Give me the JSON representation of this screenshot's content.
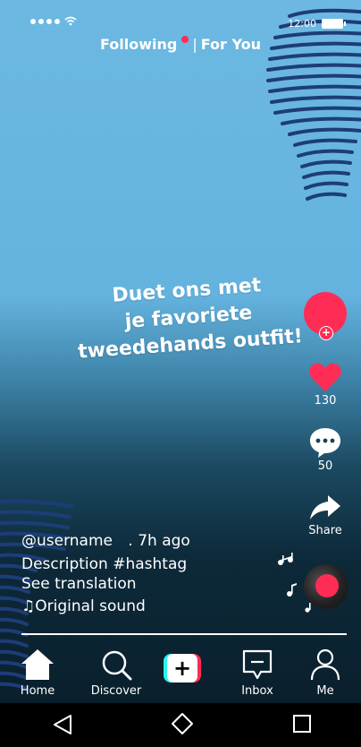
{
  "status_bar": {
    "time": "12:00"
  },
  "top_nav": {
    "following": "Following",
    "separator": "|",
    "for_you": "For You"
  },
  "headline": {
    "line1": "Duet ons met",
    "line2": "je favoriete",
    "line3": "tweedehands outfit!"
  },
  "actions": {
    "likes": "130",
    "comments": "50",
    "share_label": "Share"
  },
  "post": {
    "username": "@username",
    "time_ago": ". 7h ago",
    "description": "Description #hashtag",
    "translation": "See translation",
    "sound_icon": "♫",
    "sound": "Original sound"
  },
  "tabs": [
    {
      "label": "Home",
      "icon": "home-icon"
    },
    {
      "label": "Discover",
      "icon": "search-icon"
    },
    {
      "label": "",
      "icon": "create-plus-icon"
    },
    {
      "label": "Inbox",
      "icon": "inbox-icon"
    },
    {
      "label": "Me",
      "icon": "profile-icon"
    }
  ],
  "colors": {
    "accent": "#ff2d55",
    "cyan": "#25f4ee",
    "background_top": "#6cb8e2",
    "background_bottom": "#0a1f2c"
  }
}
